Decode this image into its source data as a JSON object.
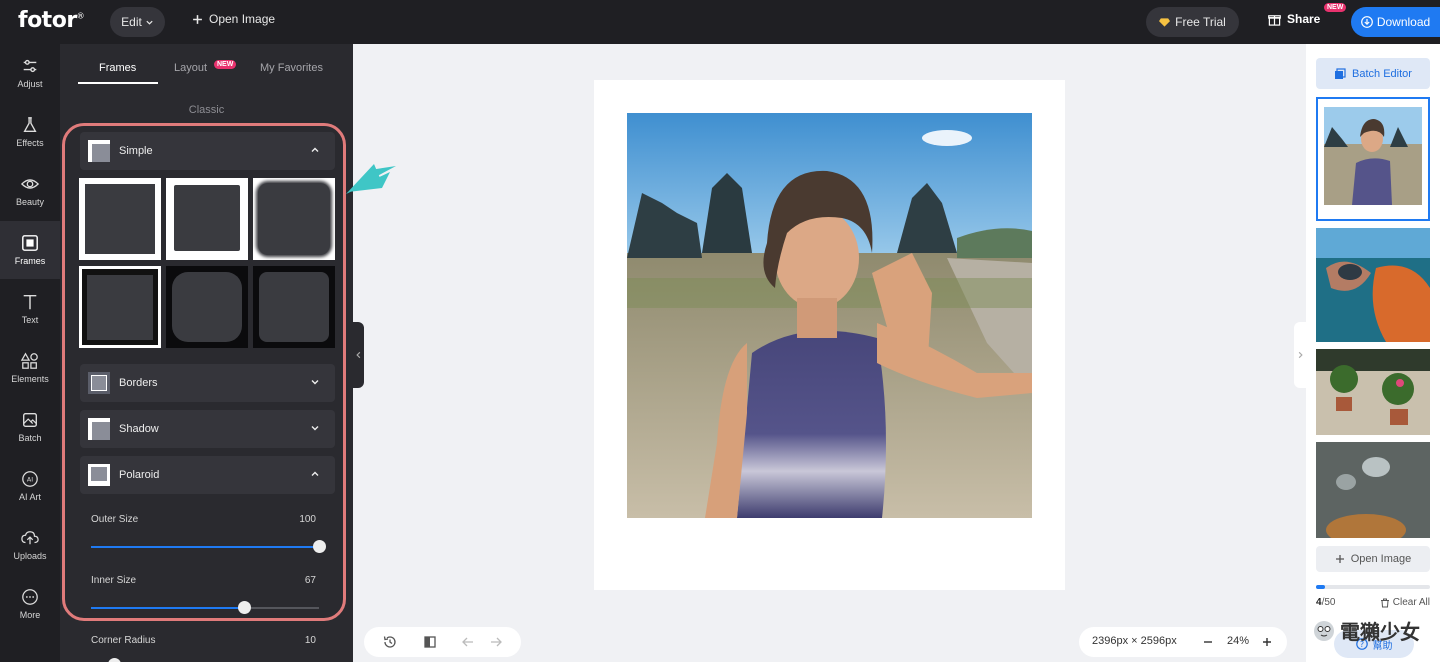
{
  "topbar": {
    "logo": "fotor",
    "logo_mark": "®",
    "edit_label": "Edit",
    "open_image_label": "Open Image",
    "free_trial_label": "Free Trial",
    "share_label": "Share",
    "share_badge": "NEW",
    "download_label": "Download"
  },
  "rail": {
    "items": [
      {
        "label": "Adjust"
      },
      {
        "label": "Effects"
      },
      {
        "label": "Beauty"
      },
      {
        "label": "Frames"
      },
      {
        "label": "Text"
      },
      {
        "label": "Elements"
      },
      {
        "label": "Batch"
      },
      {
        "label": "AI Art"
      },
      {
        "label": "Uploads"
      },
      {
        "label": "More"
      }
    ]
  },
  "panel": {
    "tabs": [
      {
        "label": "Frames"
      },
      {
        "label": "Layout",
        "badge": "NEW"
      },
      {
        "label": "My Favorites"
      }
    ],
    "section_label": "Classic",
    "accordions": {
      "simple": "Simple",
      "borders": "Borders",
      "shadow": "Shadow",
      "polaroid": "Polaroid"
    },
    "sliders": [
      {
        "label": "Outer Size",
        "value": "100",
        "fraction": 1.0
      },
      {
        "label": "Inner Size",
        "value": "67",
        "fraction": 0.67
      },
      {
        "label": "Corner Radius",
        "value": "10",
        "fraction": 0.1
      }
    ]
  },
  "canvas": {
    "dimensions": "2396px × 2596px",
    "zoom": "24%"
  },
  "right_panel": {
    "batch_editor_label": "Batch Editor",
    "open_image_label": "Open Image",
    "count_current": "4",
    "count_total": "/50",
    "progress_fraction": 0.08,
    "clear_all_label": "Clear All",
    "help_label": "幫助"
  },
  "watermark": "電獺少女",
  "colors": {
    "accent": "#1f7af2",
    "highlight": "#e07b7b",
    "arrow": "#3fc6c6",
    "new_badge": "#e8326e"
  }
}
